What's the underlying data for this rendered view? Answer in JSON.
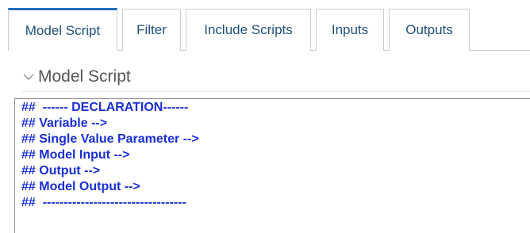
{
  "tabs": [
    {
      "label": "Model Script",
      "active": true
    },
    {
      "label": "Filter",
      "active": false
    },
    {
      "label": "Include Scripts",
      "active": false
    },
    {
      "label": "Inputs",
      "active": false
    },
    {
      "label": "Outputs",
      "active": false
    }
  ],
  "section": {
    "title": "Model Script",
    "expanded": true
  },
  "editor": {
    "lines": [
      "##  ------ DECLARATION------",
      "## Variable -->",
      "## Single Value Parameter -->",
      "## Model Input -->",
      "## Output -->",
      "## Model Output -->",
      "##  ----------------------------------"
    ]
  },
  "colors": {
    "tab_text": "#22507d",
    "active_tab_accent": "#1f6fb6",
    "code_text": "#1a2fd6",
    "section_title": "#555555"
  }
}
